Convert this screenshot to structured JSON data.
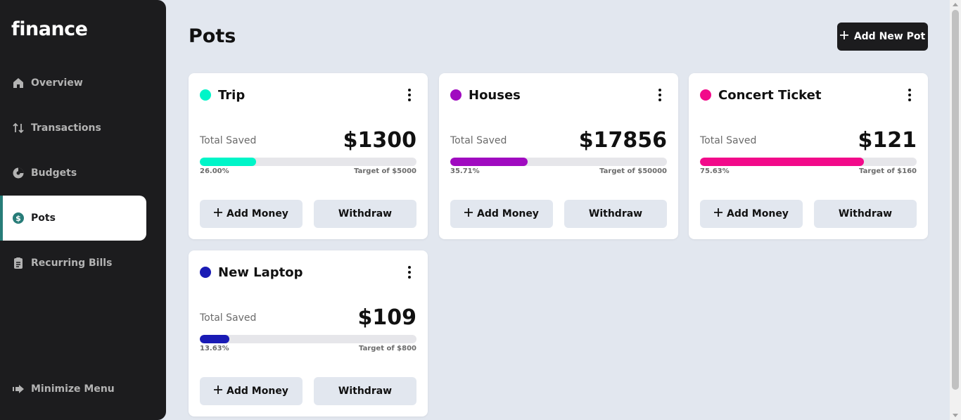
{
  "app": {
    "logo": "finance"
  },
  "sidebar": {
    "items": [
      {
        "label": "Overview",
        "icon": "home-icon"
      },
      {
        "label": "Transactions",
        "icon": "arrows-updown-icon"
      },
      {
        "label": "Budgets",
        "icon": "pie-chart-icon"
      },
      {
        "label": "Pots",
        "icon": "dollar-circle-icon",
        "active": true
      },
      {
        "label": "Recurring Bills",
        "icon": "receipt-icon"
      }
    ],
    "minimize_label": "Minimize Menu"
  },
  "header": {
    "title": "Pots",
    "add_button_label": "Add New Pot"
  },
  "labels": {
    "total_saved": "Total Saved",
    "add_money": "Add Money",
    "withdraw": "Withdraw"
  },
  "pots": [
    {
      "name": "Trip",
      "color": "#00f5c8",
      "amount": "$1300",
      "percent_label": "26.00%",
      "progress": 26.0,
      "target": "Target of $5000"
    },
    {
      "name": "Houses",
      "color": "#a00bc0",
      "amount": "$17856",
      "percent_label": "35.71%",
      "progress": 35.71,
      "target": "Target of $50000"
    },
    {
      "name": "Concert Ticket",
      "color": "#f20a8a",
      "amount": "$121",
      "percent_label": "75.63%",
      "progress": 75.63,
      "target": "Target of $160"
    },
    {
      "name": "New Laptop",
      "color": "#1a1bb5",
      "amount": "$109",
      "percent_label": "13.63%",
      "progress": 13.63,
      "target": "Target of $800"
    }
  ]
}
